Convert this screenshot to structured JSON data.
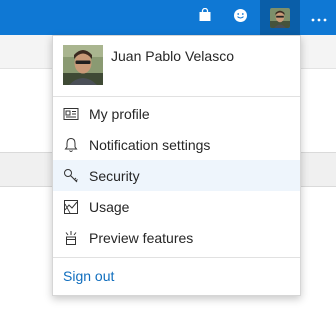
{
  "topbar": {
    "color": "#0f78d4",
    "icons": [
      "store-icon",
      "feedback-smiley-icon",
      "account-avatar",
      "more-icon"
    ]
  },
  "account_menu": {
    "user_name": "Juan Pablo Velasco",
    "items": [
      {
        "label": "My profile",
        "icon": "profile-card-icon"
      },
      {
        "label": "Notification settings",
        "icon": "bell-icon"
      },
      {
        "label": "Security",
        "icon": "key-icon",
        "highlighted": true
      },
      {
        "label": "Usage",
        "icon": "usage-icon"
      },
      {
        "label": "Preview features",
        "icon": "preview-features-icon"
      }
    ],
    "sign_out": "Sign out",
    "link_color": "#106ebe",
    "highlight_color": "#eef5fc"
  }
}
